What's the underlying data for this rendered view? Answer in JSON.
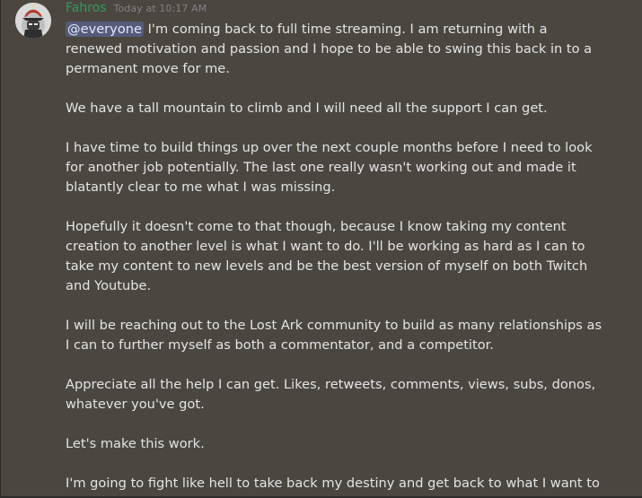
{
  "message": {
    "author": "Fahros",
    "timestamp": "Today at 10:17 AM",
    "avatar_icon": "fahros-avatar-icon",
    "mention": "@everyone",
    "paragraphs": [
      " I'm coming back to full time streaming. I am returning with a renewed motivation and passion and I hope to be able to swing this back in to a permanent move for me.",
      "We have a tall mountain to climb and I will need all the support I can get.",
      "I have time to build things up over the next couple months before I need to look for another job potentially. The last one really wasn't working out and made it blatantly clear to me what I was missing.",
      "Hopefully it doesn't come to that though, because I know taking my content creation to another level is what I want to do. I'll be working as hard as I can to take my content to new levels and be the best version of myself on both Twitch and Youtube.",
      "I will be reaching out to the Lost Ark community to build as many relationships as I can to further myself as both a commentator, and a competitor.",
      "Appreciate all the help I can get. Likes, retweets, comments, views, subs, donos, whatever you've got.",
      "Let's make this work.",
      "I'm going to fight like hell to take back my destiny and get back to what I want to be...one of your favorite creators!"
    ]
  },
  "colors": {
    "background": "#4b4740",
    "username": "#2e9b5b",
    "timestamp": "#7f8186",
    "text": "#e3e4e6",
    "mention_bg": "#555b79"
  }
}
